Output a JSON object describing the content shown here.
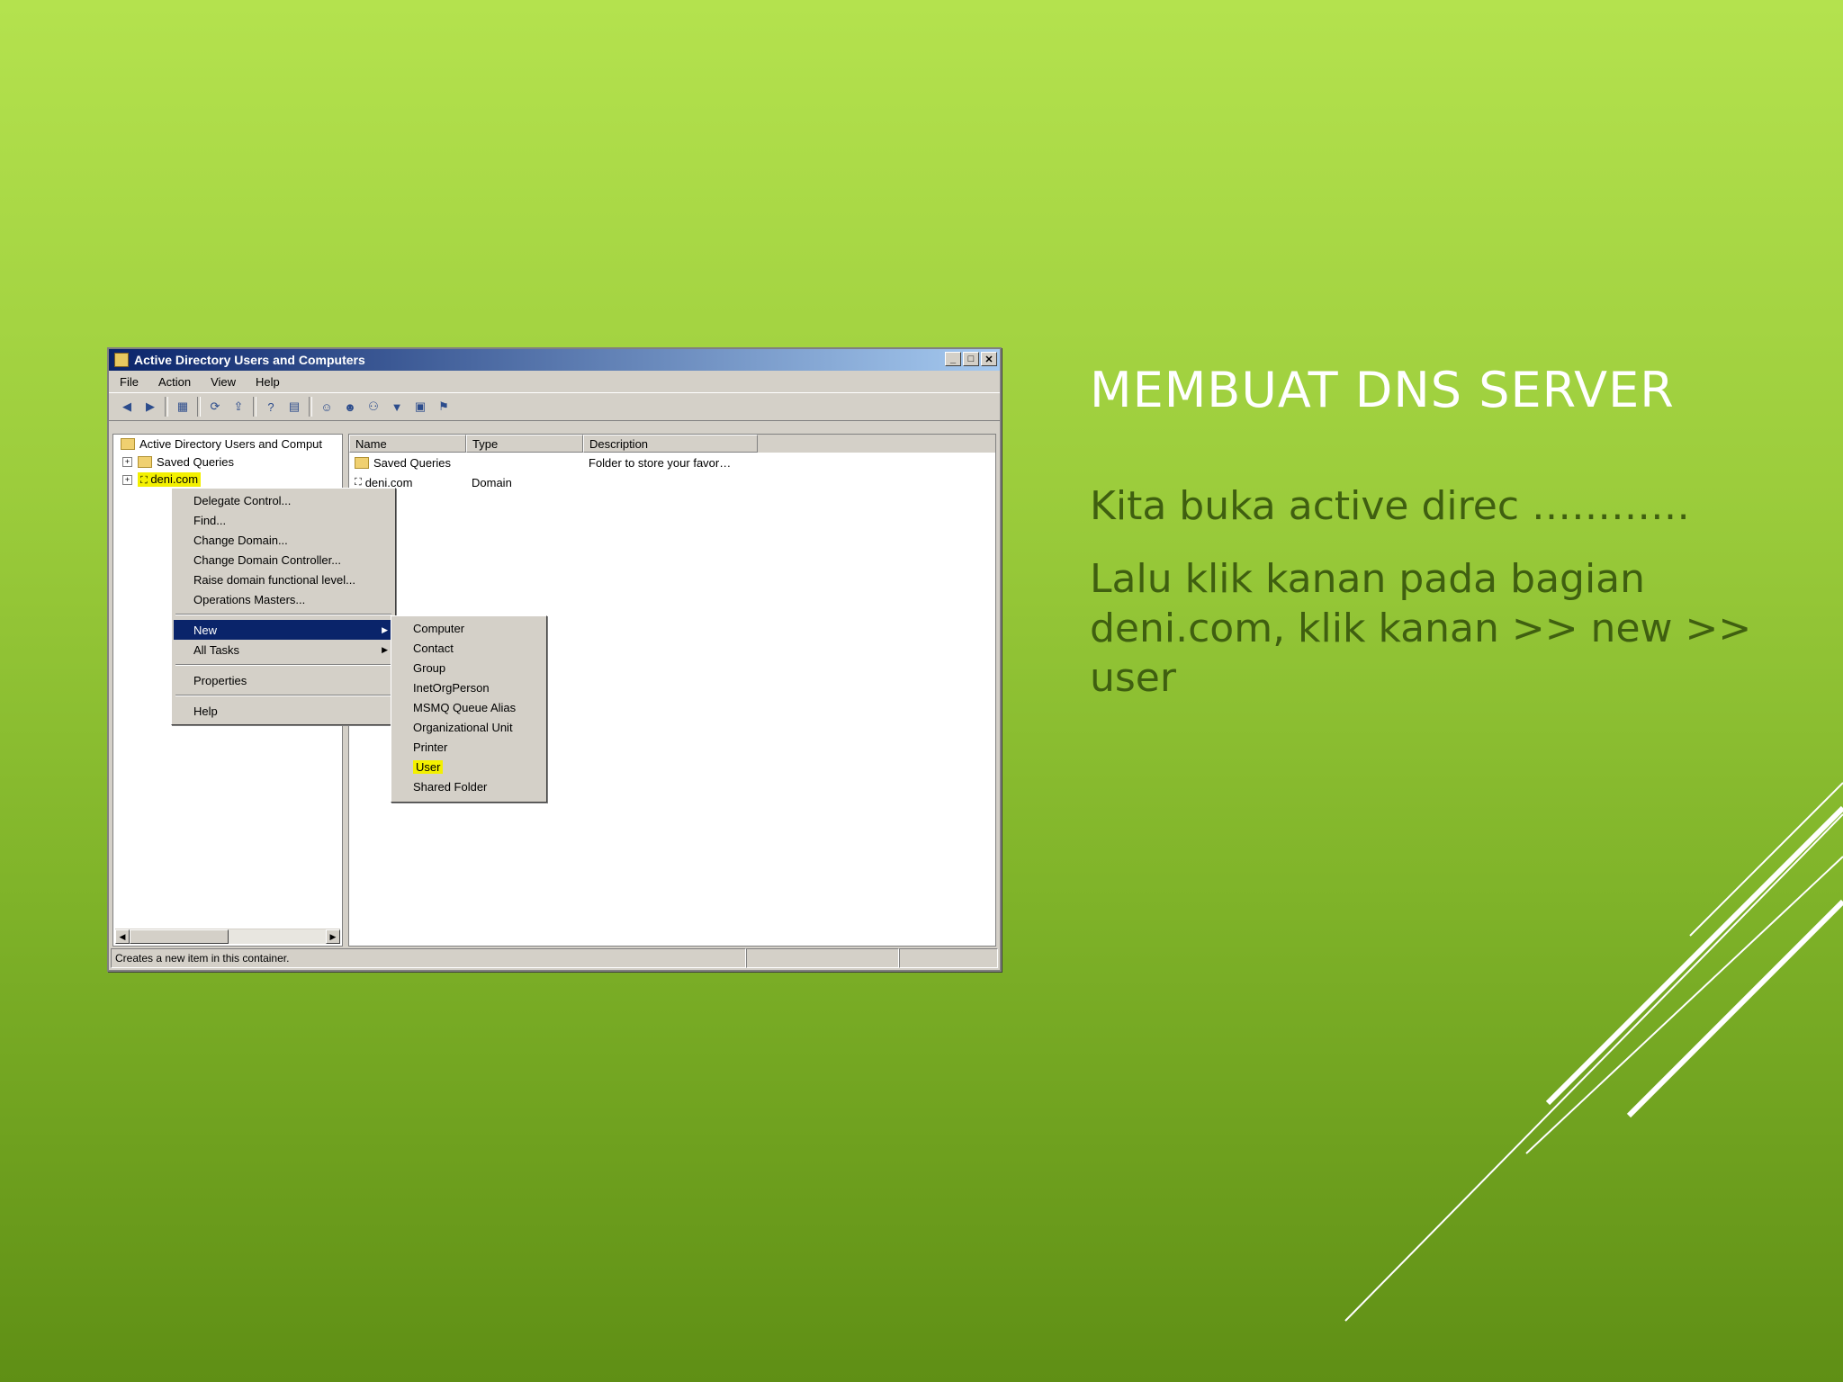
{
  "slide": {
    "title": "MEMBUAT DNS SERVER",
    "lines": [
      "Kita buka active direc …………",
      "Lalu klik kanan pada bagian deni.com, klik kanan >> new >> user"
    ],
    "colors": {
      "title": "#ffffff",
      "body": "#3f5f10",
      "highlight": "#f3f000"
    }
  },
  "window": {
    "title": "Active Directory Users and Computers",
    "menubar": [
      "File",
      "Action",
      "View",
      "Help"
    ],
    "toolbar_icons": [
      "back-icon",
      "forward-icon",
      "console-tree-icon",
      "refresh-icon",
      "export-icon",
      "help-icon",
      "view-icon",
      "user-icon",
      "users-icon",
      "group-icon",
      "filter-icon",
      "find-icon",
      "delegate-icon"
    ],
    "tree": {
      "root": "Active Directory Users and Comput",
      "items": [
        "Saved Queries",
        "deni.com"
      ]
    },
    "list": {
      "columns": [
        "Name",
        "Type",
        "Description"
      ],
      "rows": [
        {
          "name": "Saved Queries",
          "type": "",
          "description": "Folder to store your favor…"
        },
        {
          "name": "deni.com",
          "type": "Domain",
          "description": ""
        }
      ]
    },
    "status": "Creates a new item in this container."
  },
  "context_menu": {
    "items": [
      "Delegate Control...",
      "Find...",
      "Change Domain...",
      "Change Domain Controller...",
      "Raise domain functional level...",
      "Operations Masters..."
    ],
    "new": "New",
    "all_tasks": "All Tasks",
    "properties": "Properties",
    "help": "Help"
  },
  "submenu": {
    "items": [
      "Computer",
      "Contact",
      "Group",
      "InetOrgPerson",
      "MSMQ Queue Alias",
      "Organizational Unit",
      "Printer",
      "User",
      "Shared Folder"
    ],
    "highlighted": "User"
  }
}
